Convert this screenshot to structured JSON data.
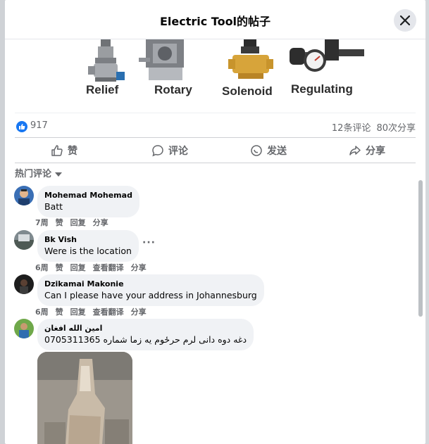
{
  "header": {
    "title": "Electric Tool的帖子"
  },
  "products": [
    {
      "label": "Relief"
    },
    {
      "label": "Rotary"
    },
    {
      "label": "Solenoid"
    },
    {
      "label": "Regulating"
    }
  ],
  "reactions": {
    "like_count": "917",
    "comments": "12条评论",
    "shares": "80次分享"
  },
  "actions": {
    "like": "赞",
    "comment": "评论",
    "send": "发送",
    "share": "分享"
  },
  "sort": {
    "label": "热门评论"
  },
  "comments": [
    {
      "name": "Mohemad Mohemad",
      "text": "Batt",
      "time": "7周",
      "like": "赞",
      "reply": "回复",
      "share": "分享"
    },
    {
      "name": "Bk Vish",
      "text": "Were is the location",
      "time": "6周",
      "like": "赞",
      "reply": "回复",
      "translate": "查看翻译",
      "share": "分享",
      "more": "···"
    },
    {
      "name": "Dzikamai Makonie",
      "text": "Can I please have your address in Johannesburg",
      "time": "6周",
      "like": "赞",
      "reply": "回复",
      "translate": "查看翻译",
      "share": "分享"
    },
    {
      "name": "امین الله افغان",
      "text": "دغه دوه دانی لرم حرځوم یه زما شماره 0705311365"
    }
  ],
  "colors": {
    "accent": "#1877f2",
    "muted": "#65676b",
    "bubble": "#f0f2f5"
  }
}
